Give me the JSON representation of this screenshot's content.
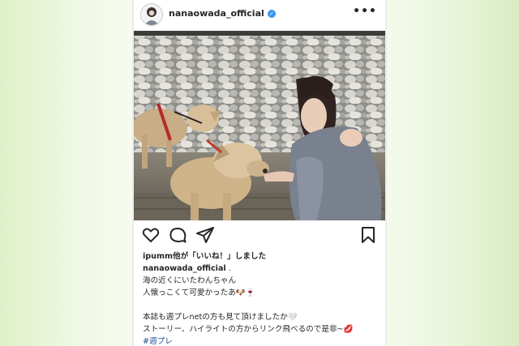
{
  "post": {
    "username": "nanaowada_official",
    "more_label": "•••",
    "likes_line": "ipumm他が「いいね！」しました",
    "caption_author": "nanaowada_official",
    "caption_author_suffix": " .",
    "caption_lines": [
      "海の近くにいたわんちゃん",
      "人懐っこくて可愛かったあ🐶🍷",
      "",
      "本誌も週プレnetの方も見て頂けましたか🤍",
      "ストーリー、ハイライトの方からリンク飛べるので是非~💋"
    ],
    "hashtag": "#週プレ"
  },
  "icons": {
    "avatar": "profile-avatar",
    "verified": "verified-badge-icon",
    "like": "heart-icon",
    "comment": "comment-bubble-icon",
    "share": "paper-plane-icon",
    "save": "bookmark-icon"
  },
  "colors": {
    "verified": "#3897f0",
    "text": "#262626",
    "hashtag": "#1e4f8c",
    "page_background": "#e3f1cf"
  }
}
